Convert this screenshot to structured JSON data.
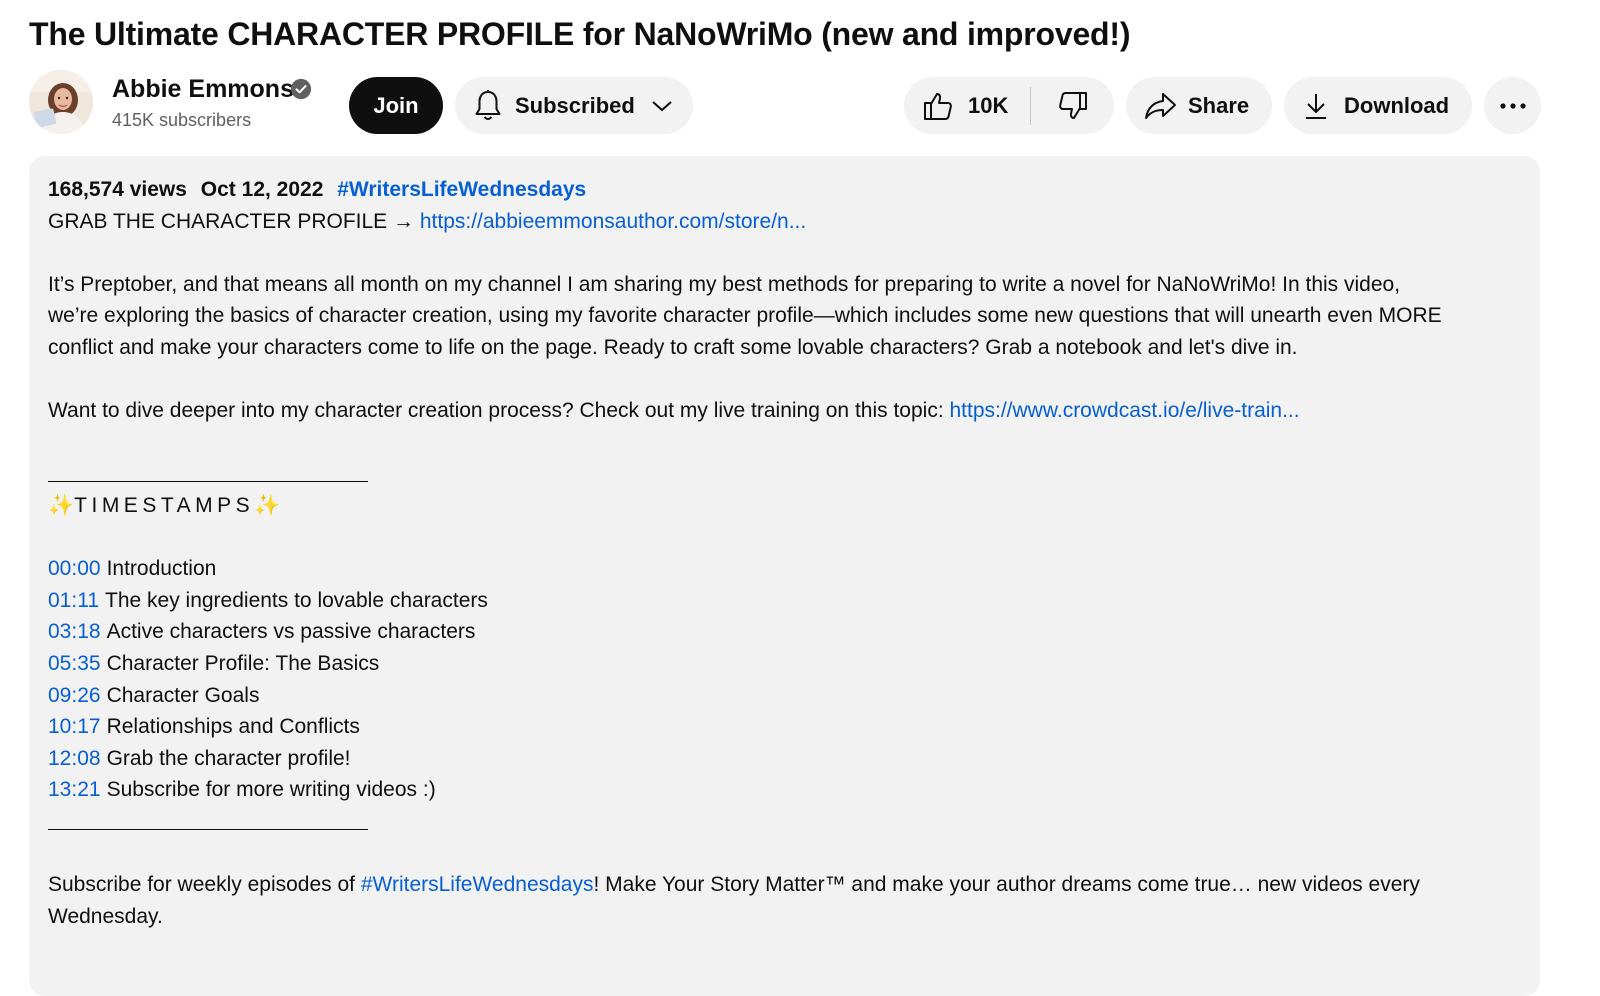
{
  "video": {
    "title": "The Ultimate CHARACTER PROFILE for NaNoWriMo (new and improved!)"
  },
  "channel": {
    "name": "Abbie Emmons",
    "subscribers": "415K subscribers",
    "verified": true
  },
  "actions": {
    "join_label": "Join",
    "subscribed_label": "Subscribed",
    "like_count": "10K",
    "share_label": "Share",
    "download_label": "Download",
    "more_label": "···"
  },
  "description": {
    "views": "168,574 views",
    "date": "Oct 12, 2022",
    "hashtag": "#WritersLifeWednesdays",
    "grab_prefix": "GRAB THE CHARACTER PROFILE → ",
    "grab_link": "https://abbieemmonsauthor.com/store/n...",
    "intro_lines": [
      "It’s Preptober, and that means all month on my channel I am sharing my best methods for preparing to write a novel for NaNoWriMo! In this video,",
      "we’re exploring the basics of character creation, using my favorite character profile—which includes some new questions that will unearth even MORE",
      "conflict and make your characters come to life on the page. Ready to craft some lovable characters? Grab a notebook and let's dive in."
    ],
    "training_prefix": "Want to dive deeper into my character creation process? Check out my live training on this topic: ",
    "training_link": "https://www.crowdcast.io/e/live-train...",
    "timestamps_heading": "TIMESTAMPS",
    "sparkle": "✨",
    "timestamps": [
      {
        "time": "00:00",
        "label": "Introduction"
      },
      {
        "time": "01:11",
        "label": "The key ingredients to lovable characters"
      },
      {
        "time": "03:18",
        "label": "Active characters vs passive characters"
      },
      {
        "time": "05:35",
        "label": "Character Profile: The Basics"
      },
      {
        "time": "09:26",
        "label": "Character Goals"
      },
      {
        "time": "10:17",
        "label": "Relationships and Conflicts"
      },
      {
        "time": "12:08",
        "label": "Grab the character profile!"
      },
      {
        "time": "13:21",
        "label": "Subscribe for more writing videos :)"
      }
    ],
    "footer_prefix": "Subscribe for weekly episodes of ",
    "footer_hashtag": "#WritersLifeWednesdays",
    "footer_suffix": "! Make Your Story Matter™ and make your author dreams come true… new videos every",
    "footer_line2": "Wednesday."
  },
  "colors": {
    "link": "#065fd4",
    "pill_bg": "#f2f2f2",
    "join_bg": "#0f0f0f",
    "desc_bg": "#f2f2f2"
  },
  "icons": [
    "verified-badge-icon",
    "bell-icon",
    "chevron-down-icon",
    "thumbs-up-icon",
    "thumbs-down-icon",
    "share-arrow-icon",
    "download-icon",
    "more-icon"
  ]
}
